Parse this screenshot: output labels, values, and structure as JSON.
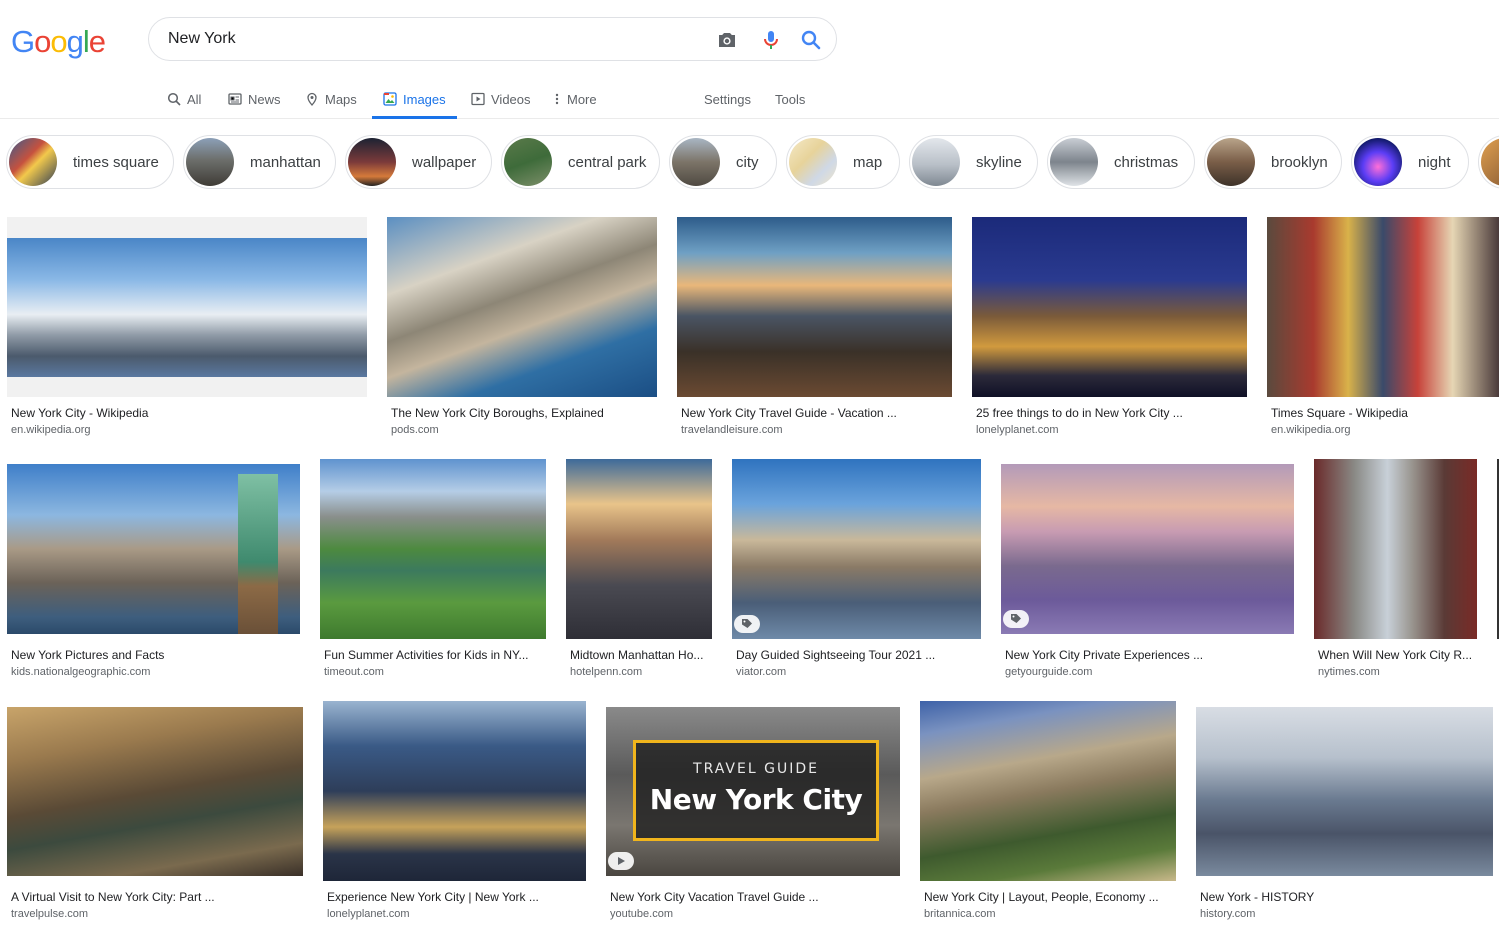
{
  "logo": {
    "letters": [
      "G",
      "o",
      "o",
      "g",
      "l",
      "e"
    ],
    "colors": [
      "#4285F4",
      "#EA4335",
      "#FBBC05",
      "#4285F4",
      "#34A853",
      "#EA4335"
    ]
  },
  "search": {
    "query": "New York"
  },
  "tabs": {
    "all": "All",
    "news": "News",
    "maps": "Maps",
    "images": "Images",
    "videos": "Videos",
    "more": "More",
    "settings": "Settings",
    "tools": "Tools",
    "active_color": "#1a73e8"
  },
  "chips": [
    {
      "label": "times square"
    },
    {
      "label": "manhattan"
    },
    {
      "label": "wallpaper"
    },
    {
      "label": "central park"
    },
    {
      "label": "city"
    },
    {
      "label": "map"
    },
    {
      "label": "skyline"
    },
    {
      "label": "christmas"
    },
    {
      "label": "brooklyn"
    },
    {
      "label": "night"
    }
  ],
  "results": [
    {
      "title": "New York City - Wikipedia",
      "source": "en.wikipedia.org"
    },
    {
      "title": "The New York City Boroughs, Explained",
      "source": "pods.com"
    },
    {
      "title": "New York City Travel Guide - Vacation ...",
      "source": "travelandleisure.com"
    },
    {
      "title": "25 free things to do in New York City ...",
      "source": "lonelyplanet.com"
    },
    {
      "title": "Times Square - Wikipedia",
      "source": "en.wikipedia.org"
    },
    {
      "title": "New York Pictures and Facts",
      "source": "kids.nationalgeographic.com"
    },
    {
      "title": "Fun Summer Activities for Kids in NY...",
      "source": "timeout.com"
    },
    {
      "title": "Midtown Manhattan Ho...",
      "source": "hotelpenn.com"
    },
    {
      "title": "Day Guided Sightseeing Tour 2021 ...",
      "source": "viator.com"
    },
    {
      "title": "New York City Private Experiences ...",
      "source": "getyourguide.com"
    },
    {
      "title": "When Will New York City R...",
      "source": "nytimes.com"
    },
    {
      "title": "A Virtual Visit to New York City: Part ...",
      "source": "travelpulse.com"
    },
    {
      "title": "Experience New York City | New York ...",
      "source": "lonelyplanet.com"
    },
    {
      "title": "New York City Vacation Travel Guide ...",
      "source": "youtube.com"
    },
    {
      "title": "New York City | Layout, People, Economy ...",
      "source": "britannica.com"
    },
    {
      "title": "New York - HISTORY",
      "source": "history.com"
    }
  ],
  "thumbnail_text": {
    "travel_guide": "TRAVEL GUIDE",
    "city": "New York City"
  },
  "icons": {
    "camera": "camera-icon",
    "mic": "mic-icon",
    "search": "search-icon",
    "product_tag": "tag-icon",
    "video_play": "play-icon"
  }
}
